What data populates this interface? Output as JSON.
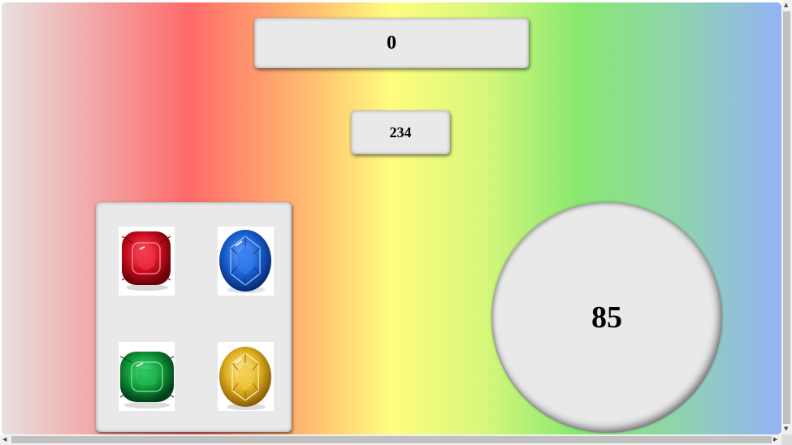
{
  "game": {
    "score": "0",
    "moves": "234",
    "timer": "85"
  },
  "board": {
    "gems": [
      {
        "name": "ruby",
        "color": "#e01020"
      },
      {
        "name": "sapphire",
        "color": "#1a5fd0"
      },
      {
        "name": "emerald",
        "color": "#119a3a"
      },
      {
        "name": "topaz",
        "color": "#e0b020"
      }
    ]
  },
  "colors": {
    "panel": "#e9e9e9",
    "gradient": [
      "#e8e0e0",
      "#ff6a6a",
      "#fffd80",
      "#88e870",
      "#94b3f5"
    ]
  }
}
